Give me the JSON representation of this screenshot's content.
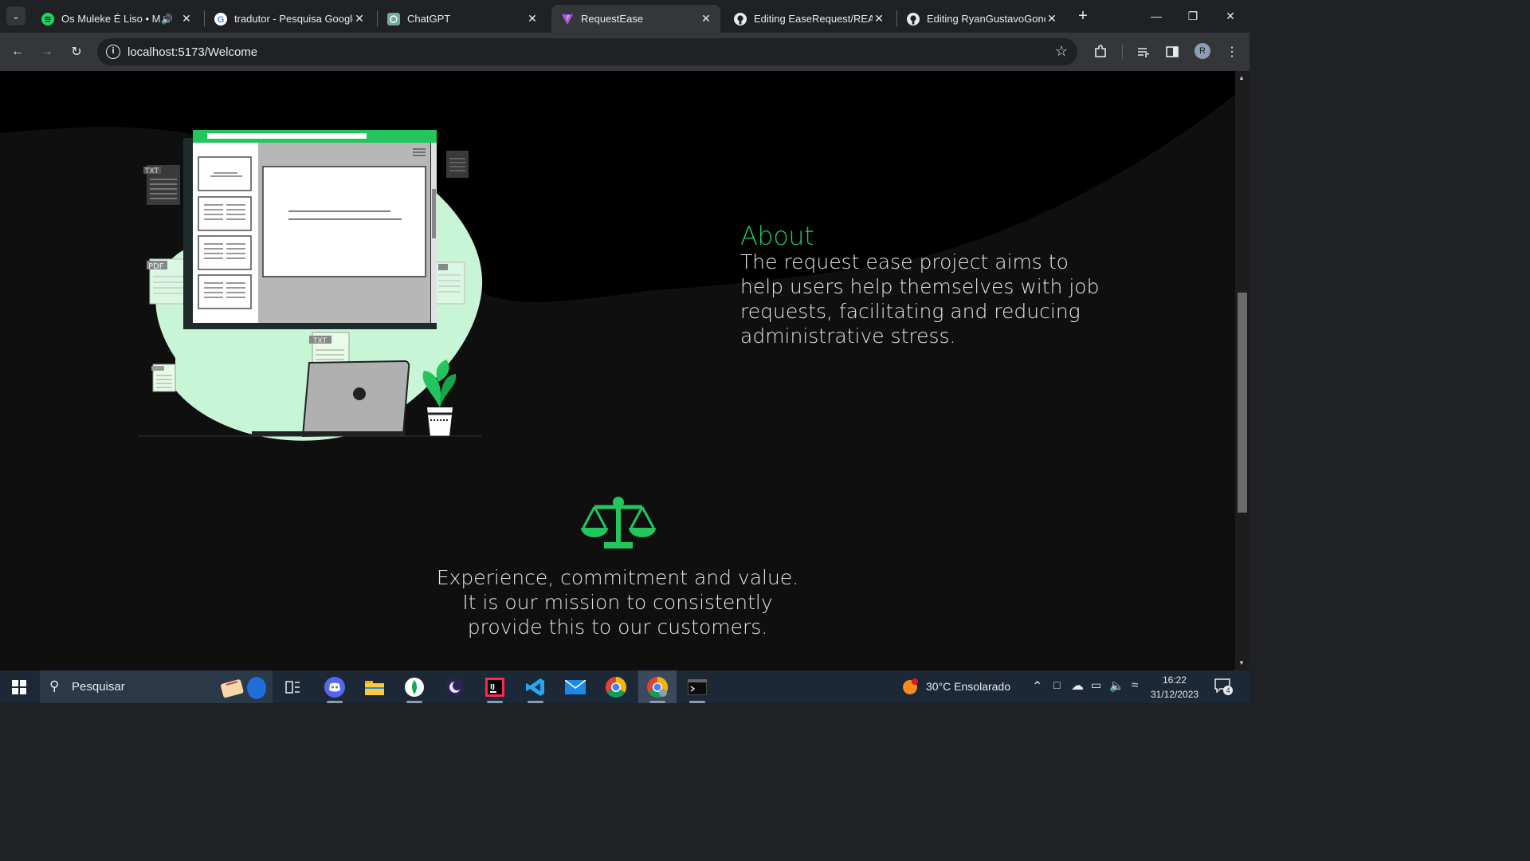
{
  "tabs": [
    {
      "title": "Os Muleke É Liso • MC",
      "icon": "spotify-icon"
    },
    {
      "title": "tradutor - Pesquisa Google",
      "icon": "google-icon"
    },
    {
      "title": "ChatGPT",
      "icon": "chatgpt-icon"
    },
    {
      "title": "RequestEase",
      "icon": "vite-icon"
    },
    {
      "title": "Editing EaseRequest/READ",
      "icon": "github-icon"
    },
    {
      "title": "Editing RyanGustavoGonc",
      "icon": "github-icon"
    }
  ],
  "address_bar": {
    "url": "localhost:5173/Welcome"
  },
  "avatar_letter": "R",
  "page": {
    "about_title": "About",
    "about_text": "The request ease project aims to help users help themselves with job requests, facilitating and reducing administrative stress.",
    "mission_text": "Experience, commitment and value. It is our mission to consistently provide this to our customers."
  },
  "illustration_labels": {
    "txt": "TXT",
    "pdf": "PDF",
    "txt2": "TXT"
  },
  "taskbar": {
    "search_placeholder": "Pesquisar",
    "weather": "30°C  Ensolarado",
    "time": "16:22",
    "date": "31/12/2023",
    "notification_count": "4"
  },
  "colors": {
    "accent": "#22c55e",
    "blob": "#c8f5d5",
    "page_bg": "#0f0f0f"
  }
}
